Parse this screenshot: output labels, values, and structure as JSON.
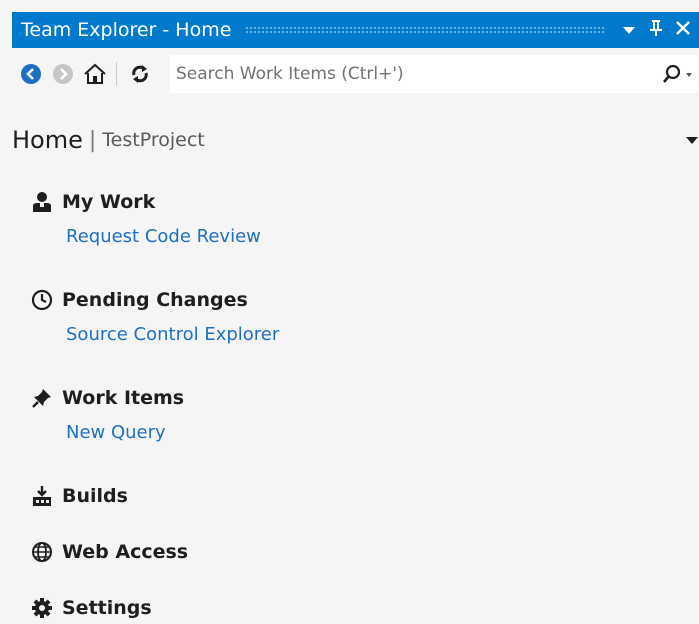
{
  "window": {
    "title": "Team Explorer - Home",
    "dropdown_icon": "dropdown-arrow-icon",
    "pin_icon": "pin-icon",
    "close_icon": "close-icon"
  },
  "toolbar": {
    "back_icon": "back-arrow-icon",
    "forward_icon": "forward-arrow-icon",
    "home_icon": "home-icon",
    "refresh_icon": "refresh-icon",
    "search_placeholder": "Search Work Items (Ctrl+')",
    "search_icon": "search-icon"
  },
  "header": {
    "title": "Home",
    "separator": "|",
    "project": "TestProject"
  },
  "sections": [
    {
      "id": "my-work",
      "icon": "person-icon",
      "title": "My Work",
      "link": "Request Code Review"
    },
    {
      "id": "pending-changes",
      "icon": "clock-icon",
      "title": "Pending Changes",
      "link": "Source Control Explorer"
    },
    {
      "id": "work-items",
      "icon": "pushpin-icon",
      "title": "Work Items",
      "link": "New Query"
    },
    {
      "id": "builds",
      "icon": "builds-icon",
      "title": "Builds"
    },
    {
      "id": "web-access",
      "icon": "globe-icon",
      "title": "Web Access"
    },
    {
      "id": "settings",
      "icon": "gear-icon",
      "title": "Settings"
    }
  ],
  "colors": {
    "title_bar": "#007acc",
    "link": "#1e6fc4",
    "background": "#f5f5f5",
    "back_button": "#1e6fc4"
  }
}
